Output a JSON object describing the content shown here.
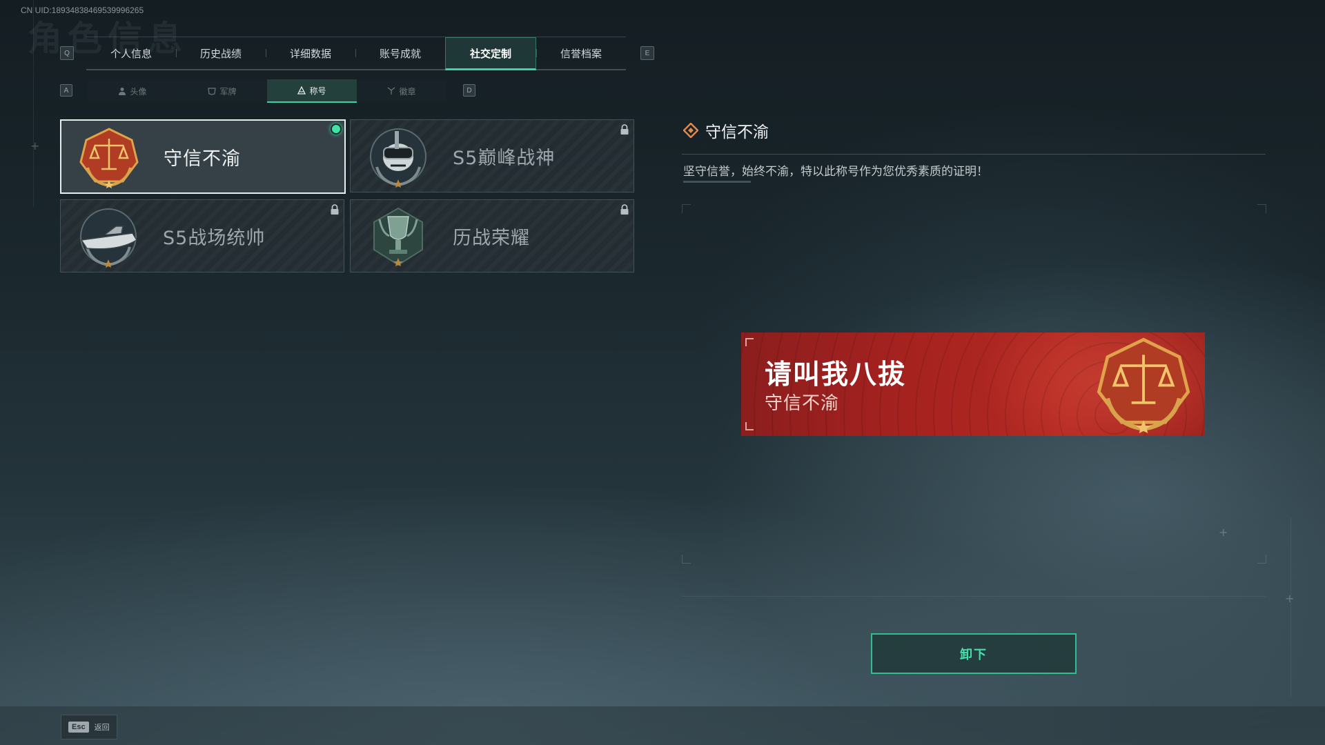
{
  "uid_text": "CN UID:18934838469539996265",
  "header": {
    "ghost_title": "角色信息",
    "prev_key": "Q",
    "next_key": "E"
  },
  "main_tabs": [
    {
      "label": "个人信息",
      "active": false
    },
    {
      "label": "历史战绩",
      "active": false
    },
    {
      "label": "详细数据",
      "active": false
    },
    {
      "label": "账号成就",
      "active": false
    },
    {
      "label": "社交定制",
      "active": true
    },
    {
      "label": "信誉档案",
      "active": false
    }
  ],
  "sub_tabs": {
    "prev_key": "A",
    "next_key": "D",
    "items": [
      {
        "label": "头像",
        "icon": "person-icon",
        "active": false
      },
      {
        "label": "军牌",
        "icon": "dogtag-icon",
        "active": false
      },
      {
        "label": "称号",
        "icon": "title-icon",
        "active": true
      },
      {
        "label": "徽章",
        "icon": "badge-icon",
        "active": false
      }
    ]
  },
  "titles": [
    {
      "label": "守信不渝",
      "emblem": "scales-emblem-icon",
      "selected": true,
      "equipped": true,
      "locked": false
    },
    {
      "label": "S5巅峰战神",
      "emblem": "diver-skull-emblem-icon",
      "selected": false,
      "equipped": false,
      "locked": true
    },
    {
      "label": "S5战场统帅",
      "emblem": "speedboat-emblem-icon",
      "selected": false,
      "equipped": false,
      "locked": true
    },
    {
      "label": "历战荣耀",
      "emblem": "trophy-emblem-icon",
      "selected": false,
      "equipped": false,
      "locked": true
    }
  ],
  "detail": {
    "title": "守信不渝",
    "description": "坚守信誉，始终不渝，特以此称号作为您优秀素质的证明！"
  },
  "banner": {
    "player_name": "请叫我八拔",
    "title": "守信不渝",
    "emblem": "scales-emblem-icon"
  },
  "actions": {
    "unequip_label": "卸下"
  },
  "footer": {
    "esc_key": "Esc",
    "back_label": "返回"
  },
  "colors": {
    "accent": "#3fd3a3",
    "banner_red": "#a5221f",
    "equipped_dot": "#3fe3a3"
  }
}
